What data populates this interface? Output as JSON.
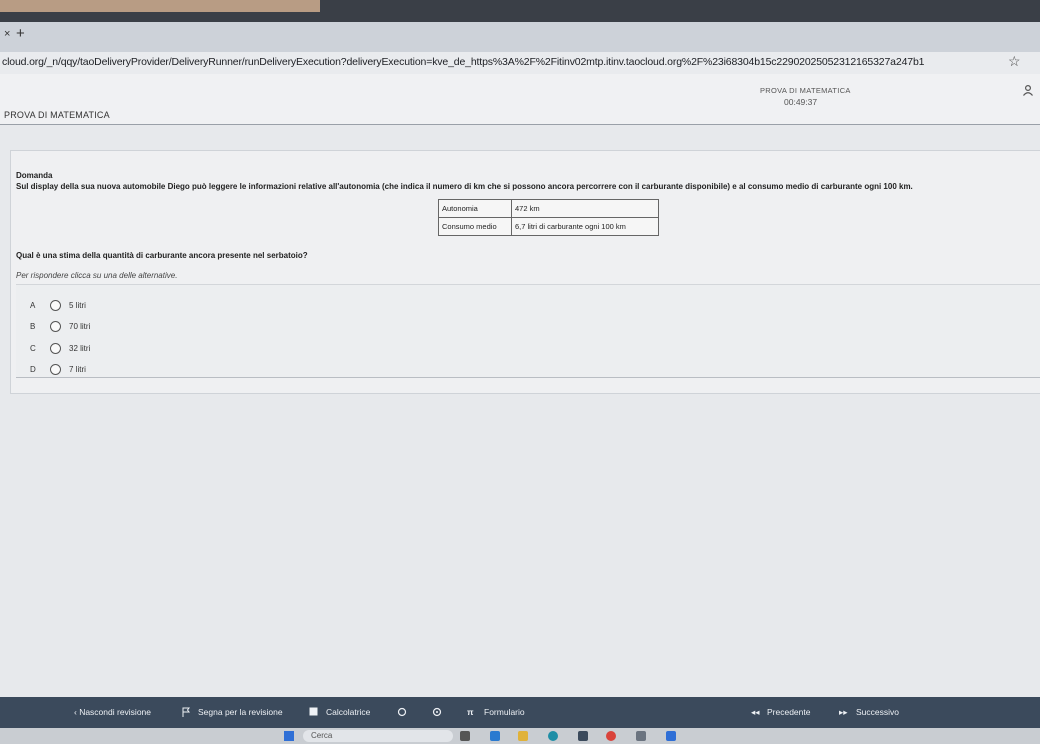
{
  "browser": {
    "url": "cloud.org/_n/qqy/taoDeliveryProvider/DeliveryRunner/runDeliveryExecution?deliveryExecution=kve_de_https%3A%2F%2Fitinv02mtp.itinv.taocloud.org%2F%23i68304b15c22902025052312165327a247b1",
    "new_tab": "+",
    "tab_close": "×",
    "star": "☆"
  },
  "header": {
    "app_title": "PROVA DI MATEMATICA",
    "test_title": "PROVA DI MATEMATICA",
    "timer": "00:49:37",
    "user_icon": "user-icon"
  },
  "item": {
    "label": "Domanda",
    "stem": "Sul display della sua nuova automobile Diego può leggere le informazioni relative all'autonomia (che indica il numero di km che si possono ancora percorrere con il carburante disponibile) e al consumo medio di carburante ogni 100 km.",
    "table": [
      {
        "key": "Autonomia",
        "value": "472 km"
      },
      {
        "key": "Consumo medio",
        "value": "6,7 litri di carburante ogni 100 km"
      }
    ],
    "question": "Qual è una stima della quantità di carburante ancora presente nel serbatoio?",
    "instruction": "Per rispondere clicca su una delle alternative.",
    "options": [
      {
        "letter": "A",
        "text": "5 litri"
      },
      {
        "letter": "B",
        "text": "70 litri"
      },
      {
        "letter": "C",
        "text": "32 litri"
      },
      {
        "letter": "D",
        "text": "7 litri"
      }
    ]
  },
  "toolbar": {
    "hide_review": "‹  Nascondi revisione",
    "flag_review": "Segna per la revisione",
    "calculator": "Calcolatrice",
    "formulary": "Formulario",
    "previous": "Precedente",
    "next": "Successivo"
  },
  "taskbar": {
    "search": "Cerca"
  }
}
